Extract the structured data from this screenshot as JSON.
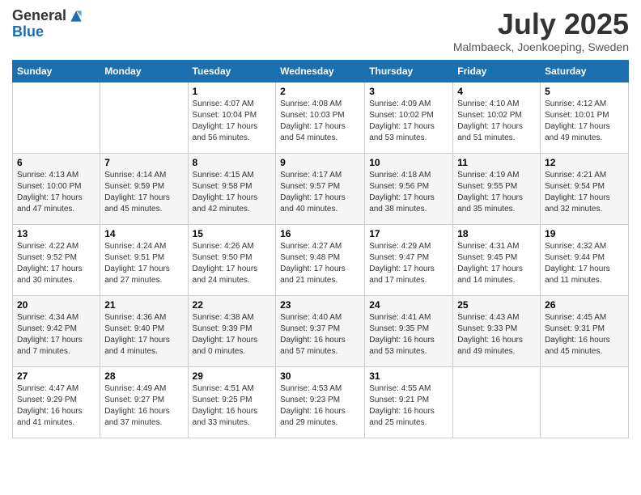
{
  "header": {
    "logo_general": "General",
    "logo_blue": "Blue",
    "month_title": "July 2025",
    "location": "Malmbaeck, Joenkoeping, Sweden"
  },
  "calendar": {
    "days_of_week": [
      "Sunday",
      "Monday",
      "Tuesday",
      "Wednesday",
      "Thursday",
      "Friday",
      "Saturday"
    ],
    "weeks": [
      [
        {
          "day": "",
          "info": ""
        },
        {
          "day": "",
          "info": ""
        },
        {
          "day": "1",
          "info": "Sunrise: 4:07 AM\nSunset: 10:04 PM\nDaylight: 17 hours and 56 minutes."
        },
        {
          "day": "2",
          "info": "Sunrise: 4:08 AM\nSunset: 10:03 PM\nDaylight: 17 hours and 54 minutes."
        },
        {
          "day": "3",
          "info": "Sunrise: 4:09 AM\nSunset: 10:02 PM\nDaylight: 17 hours and 53 minutes."
        },
        {
          "day": "4",
          "info": "Sunrise: 4:10 AM\nSunset: 10:02 PM\nDaylight: 17 hours and 51 minutes."
        },
        {
          "day": "5",
          "info": "Sunrise: 4:12 AM\nSunset: 10:01 PM\nDaylight: 17 hours and 49 minutes."
        }
      ],
      [
        {
          "day": "6",
          "info": "Sunrise: 4:13 AM\nSunset: 10:00 PM\nDaylight: 17 hours and 47 minutes."
        },
        {
          "day": "7",
          "info": "Sunrise: 4:14 AM\nSunset: 9:59 PM\nDaylight: 17 hours and 45 minutes."
        },
        {
          "day": "8",
          "info": "Sunrise: 4:15 AM\nSunset: 9:58 PM\nDaylight: 17 hours and 42 minutes."
        },
        {
          "day": "9",
          "info": "Sunrise: 4:17 AM\nSunset: 9:57 PM\nDaylight: 17 hours and 40 minutes."
        },
        {
          "day": "10",
          "info": "Sunrise: 4:18 AM\nSunset: 9:56 PM\nDaylight: 17 hours and 38 minutes."
        },
        {
          "day": "11",
          "info": "Sunrise: 4:19 AM\nSunset: 9:55 PM\nDaylight: 17 hours and 35 minutes."
        },
        {
          "day": "12",
          "info": "Sunrise: 4:21 AM\nSunset: 9:54 PM\nDaylight: 17 hours and 32 minutes."
        }
      ],
      [
        {
          "day": "13",
          "info": "Sunrise: 4:22 AM\nSunset: 9:52 PM\nDaylight: 17 hours and 30 minutes."
        },
        {
          "day": "14",
          "info": "Sunrise: 4:24 AM\nSunset: 9:51 PM\nDaylight: 17 hours and 27 minutes."
        },
        {
          "day": "15",
          "info": "Sunrise: 4:26 AM\nSunset: 9:50 PM\nDaylight: 17 hours and 24 minutes."
        },
        {
          "day": "16",
          "info": "Sunrise: 4:27 AM\nSunset: 9:48 PM\nDaylight: 17 hours and 21 minutes."
        },
        {
          "day": "17",
          "info": "Sunrise: 4:29 AM\nSunset: 9:47 PM\nDaylight: 17 hours and 17 minutes."
        },
        {
          "day": "18",
          "info": "Sunrise: 4:31 AM\nSunset: 9:45 PM\nDaylight: 17 hours and 14 minutes."
        },
        {
          "day": "19",
          "info": "Sunrise: 4:32 AM\nSunset: 9:44 PM\nDaylight: 17 hours and 11 minutes."
        }
      ],
      [
        {
          "day": "20",
          "info": "Sunrise: 4:34 AM\nSunset: 9:42 PM\nDaylight: 17 hours and 7 minutes."
        },
        {
          "day": "21",
          "info": "Sunrise: 4:36 AM\nSunset: 9:40 PM\nDaylight: 17 hours and 4 minutes."
        },
        {
          "day": "22",
          "info": "Sunrise: 4:38 AM\nSunset: 9:39 PM\nDaylight: 17 hours and 0 minutes."
        },
        {
          "day": "23",
          "info": "Sunrise: 4:40 AM\nSunset: 9:37 PM\nDaylight: 16 hours and 57 minutes."
        },
        {
          "day": "24",
          "info": "Sunrise: 4:41 AM\nSunset: 9:35 PM\nDaylight: 16 hours and 53 minutes."
        },
        {
          "day": "25",
          "info": "Sunrise: 4:43 AM\nSunset: 9:33 PM\nDaylight: 16 hours and 49 minutes."
        },
        {
          "day": "26",
          "info": "Sunrise: 4:45 AM\nSunset: 9:31 PM\nDaylight: 16 hours and 45 minutes."
        }
      ],
      [
        {
          "day": "27",
          "info": "Sunrise: 4:47 AM\nSunset: 9:29 PM\nDaylight: 16 hours and 41 minutes."
        },
        {
          "day": "28",
          "info": "Sunrise: 4:49 AM\nSunset: 9:27 PM\nDaylight: 16 hours and 37 minutes."
        },
        {
          "day": "29",
          "info": "Sunrise: 4:51 AM\nSunset: 9:25 PM\nDaylight: 16 hours and 33 minutes."
        },
        {
          "day": "30",
          "info": "Sunrise: 4:53 AM\nSunset: 9:23 PM\nDaylight: 16 hours and 29 minutes."
        },
        {
          "day": "31",
          "info": "Sunrise: 4:55 AM\nSunset: 9:21 PM\nDaylight: 16 hours and 25 minutes."
        },
        {
          "day": "",
          "info": ""
        },
        {
          "day": "",
          "info": ""
        }
      ]
    ]
  }
}
